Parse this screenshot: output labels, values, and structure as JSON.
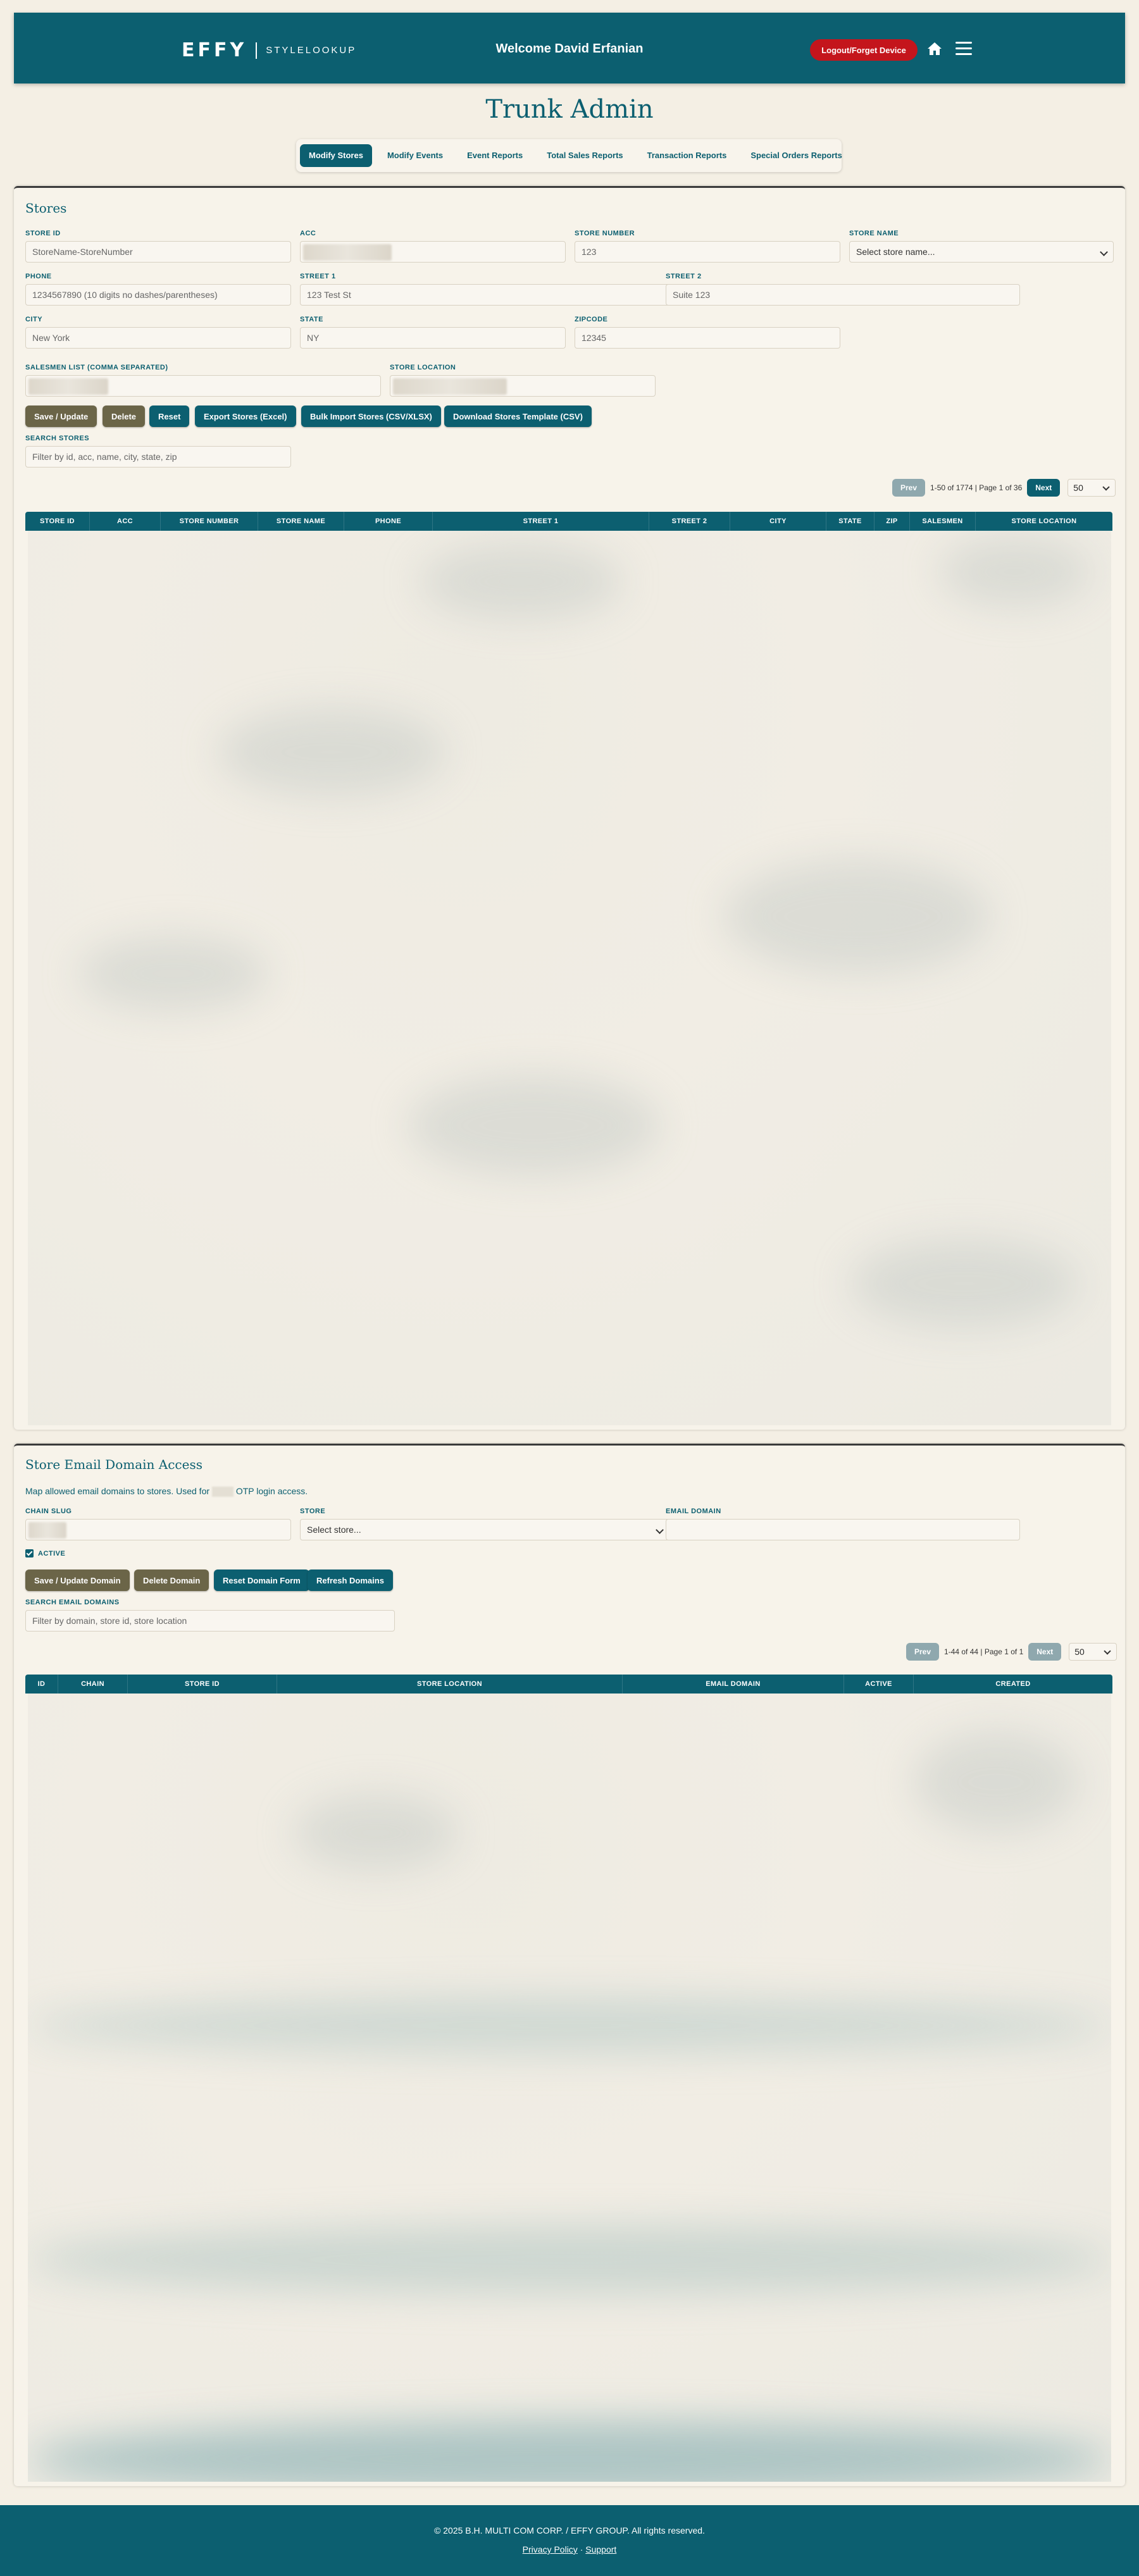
{
  "header": {
    "logo_mark": "EFFY",
    "logo_text": "STYLELOOKUP",
    "welcome": "Welcome David Erfanian",
    "logout_label": "Logout/Forget Device"
  },
  "page_title": "Trunk Admin",
  "tabs": [
    {
      "label": "Modify Stores",
      "active": true
    },
    {
      "label": "Modify Events"
    },
    {
      "label": "Event Reports"
    },
    {
      "label": "Total Sales Reports"
    },
    {
      "label": "Transaction Reports"
    },
    {
      "label": "Special Orders Reports"
    }
  ],
  "stores": {
    "title": "Stores",
    "fields": {
      "store_id": {
        "label": "Store ID",
        "placeholder": "StoreName-StoreNumber"
      },
      "acc": {
        "label": "ACC"
      },
      "store_number": {
        "label": "Store Number",
        "placeholder": "123"
      },
      "store_name": {
        "label": "Store Name",
        "value": "Select store name..."
      },
      "phone": {
        "label": "Phone",
        "placeholder": "1234567890 (10 digits no dashes/parentheses)"
      },
      "street1": {
        "label": "Street 1",
        "placeholder": "123 Test St"
      },
      "street2": {
        "label": "Street 2",
        "placeholder": "Suite 123"
      },
      "city": {
        "label": "City",
        "placeholder": "New York"
      },
      "state": {
        "label": "State",
        "placeholder": "NY"
      },
      "zipcode": {
        "label": "Zipcode",
        "placeholder": "12345"
      },
      "salesmen": {
        "label": "Salesmen List (comma separated)"
      },
      "store_location": {
        "label": "Store Location"
      }
    },
    "buttons": {
      "save": "Save / Update",
      "delete": "Delete",
      "reset": "Reset",
      "export": "Export Stores (Excel)",
      "bulk": "Bulk Import Stores (CSV/XLSX)",
      "template": "Download Stores Template (CSV)"
    },
    "search": {
      "label": "Search Stores",
      "placeholder": "Filter by id, acc, name, city, state, zip"
    },
    "pager": {
      "prev": "Prev",
      "info": "1-50 of 1774 | Page 1 of 36",
      "next": "Next",
      "page_size": "50"
    },
    "columns": [
      "Store ID",
      "ACC",
      "Store Number",
      "Store Name",
      "Phone",
      "Street 1",
      "Street 2",
      "City",
      "State",
      "Zip",
      "Salesmen",
      "Store Location"
    ]
  },
  "domains": {
    "title": "Store Email Domain Access",
    "description_pre": "Map allowed email domains to stores. Used for",
    "description_post": "OTP login access.",
    "fields": {
      "chain_slug": {
        "label": "Chain Slug"
      },
      "store": {
        "label": "Store",
        "value": "Select store..."
      },
      "email_domain": {
        "label": "Email Domain"
      },
      "active": {
        "label": "Active"
      }
    },
    "buttons": {
      "save": "Save / Update Domain",
      "delete": "Delete Domain",
      "reset": "Reset Domain Form",
      "refresh": "Refresh Domains"
    },
    "search": {
      "label": "Search Email Domains",
      "placeholder": "Filter by domain, store id, store location"
    },
    "pager": {
      "prev": "Prev",
      "info": "1-44 of 44 | Page 1 of 1",
      "next": "Next",
      "page_size": "50"
    },
    "columns": [
      "ID",
      "Chain",
      "Store ID",
      "Store Location",
      "Email Domain",
      "Active",
      "Created"
    ]
  },
  "footer": {
    "copyright": "© 2025 B.H. MULTI COM CORP. / EFFY GROUP. All rights reserved.",
    "privacy": "Privacy Policy",
    "separator": "·",
    "support": "Support"
  }
}
